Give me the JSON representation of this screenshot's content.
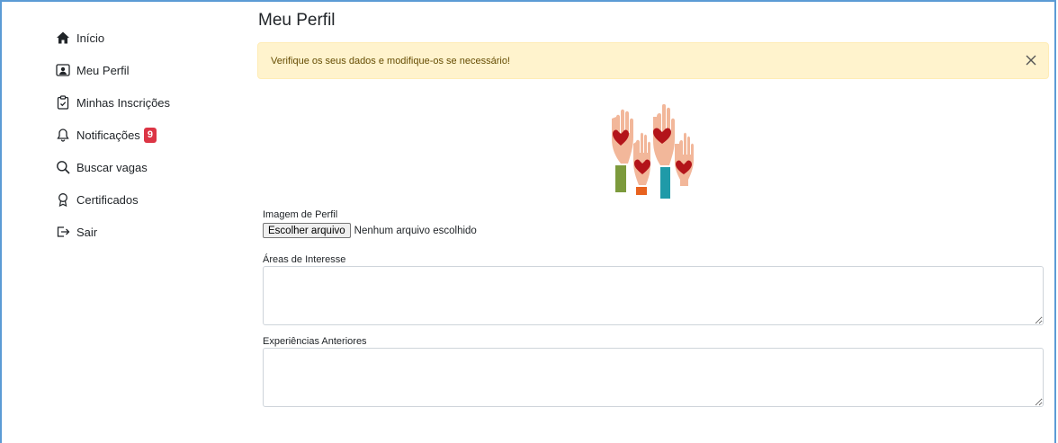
{
  "sidebar": {
    "items": [
      {
        "label": "Início",
        "icon": "home-icon"
      },
      {
        "label": "Meu Perfil",
        "icon": "profile-card-icon"
      },
      {
        "label": "Minhas Inscrições",
        "icon": "clipboard-check-icon"
      },
      {
        "label": "Notificações",
        "icon": "bell-icon",
        "badge": "9"
      },
      {
        "label": "Buscar vagas",
        "icon": "search-icon"
      },
      {
        "label": "Certificados",
        "icon": "award-icon"
      },
      {
        "label": "Sair",
        "icon": "logout-icon"
      }
    ]
  },
  "main": {
    "title": "Meu Perfil",
    "alert": {
      "message": "Verifique os seus dados e modifique-os se necessário!",
      "icon": "close-icon"
    },
    "hero_image": "raised-hands-hearts-illustration",
    "profile_image": {
      "label": "Imagem de Perfil",
      "button": "Escolher arquivo",
      "status": "Nenhum arquivo escolhido"
    },
    "interests": {
      "label": "Áreas de Interesse",
      "value": ""
    },
    "experiences": {
      "label": "Experiências Anteriores",
      "value": ""
    }
  },
  "colors": {
    "alert_bg": "#fff3cd",
    "badge": "#dc3545",
    "frame": "#5b9bd5"
  }
}
